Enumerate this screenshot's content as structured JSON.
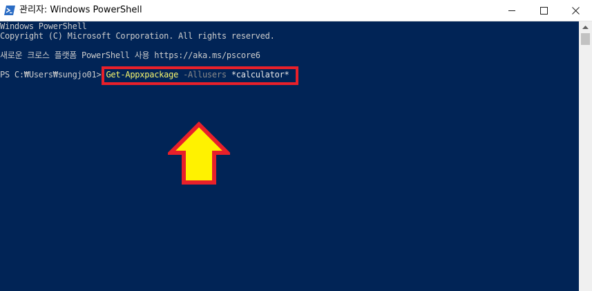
{
  "window": {
    "title": "관리자: Windows PowerShell",
    "controls": {
      "minimize": "minimize-icon",
      "maximize": "maximize-icon",
      "close": "close-icon"
    }
  },
  "console": {
    "lines": [
      "Windows PowerShell",
      "Copyright (C) Microsoft Corporation. All rights reserved.",
      "새로운 크로스 플랫폼 PowerShell 사용 https://aka.ms/pscore6"
    ],
    "prompt": "PS C:₩Users₩sungjo01> ",
    "command": {
      "name": "Get-Appxpackage",
      "parameter": "-Allusers",
      "argument": "*calculator*"
    }
  },
  "colors": {
    "console_bg": "#012456",
    "highlight": "#e8202a",
    "arrow_fill": "#fff200"
  },
  "annotation": {
    "arrow_icon": "up-arrow-icon",
    "box": "highlight-box"
  }
}
